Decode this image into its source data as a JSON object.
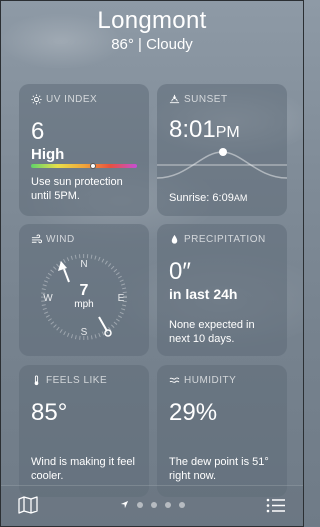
{
  "header": {
    "city": "Longmont",
    "temp_condition": "86°  |  Cloudy"
  },
  "uv": {
    "label": "UV INDEX",
    "value": "6",
    "level": "High",
    "note": "Use sun protection until 5PM.",
    "index_fraction": 0.5
  },
  "sunset": {
    "label": "SUNSET",
    "time": "8:01",
    "ampm": "PM",
    "sunrise": "Sunrise: 6:09",
    "sunrise_ampm": "AM"
  },
  "wind": {
    "label": "WIND",
    "speed": "7",
    "unit": "mph",
    "n": "N",
    "e": "E",
    "s": "S",
    "w": "W"
  },
  "precip": {
    "label": "PRECIPITATION",
    "value": "0″",
    "period": "in last 24h",
    "note": "None expected in next 10 days."
  },
  "feels": {
    "label": "FEELS LIKE",
    "value": "85°",
    "note": "Wind is making it feel cooler."
  },
  "humidity": {
    "label": "HUMIDITY",
    "value": "29%",
    "note": "The dew point is 51° right now."
  },
  "icons": {
    "map": "map-icon",
    "location": "location-arrow-icon",
    "list": "list-icon",
    "sun": "sun-icon",
    "sunset": "sunset-icon",
    "wind": "wind-icon",
    "drop": "raindrop-icon",
    "thermometer": "thermometer-icon",
    "humidity": "humidity-icon"
  },
  "colors": {
    "uv_gradient": [
      "#5fd36a",
      "#e8e04a",
      "#f0a53a",
      "#e8513f",
      "#c54fd6"
    ]
  }
}
